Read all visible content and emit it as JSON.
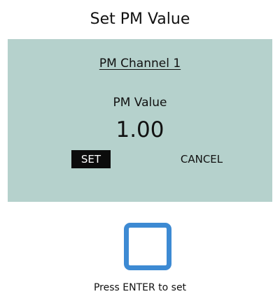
{
  "title": "Set PM Value",
  "panel": {
    "heading": "PM Channel 1",
    "value_label": "PM Value",
    "value": "1.00",
    "set_label": "SET",
    "cancel_label": "CANCEL"
  },
  "enter_key": {
    "icon": "enter-key-square-icon",
    "hint": "Press ENTER to set"
  },
  "colors": {
    "panel_background": "#b5d1cc",
    "selected_background": "#0c0c0c",
    "selected_text": "#ffffff",
    "key_border": "#3d8ad3"
  }
}
